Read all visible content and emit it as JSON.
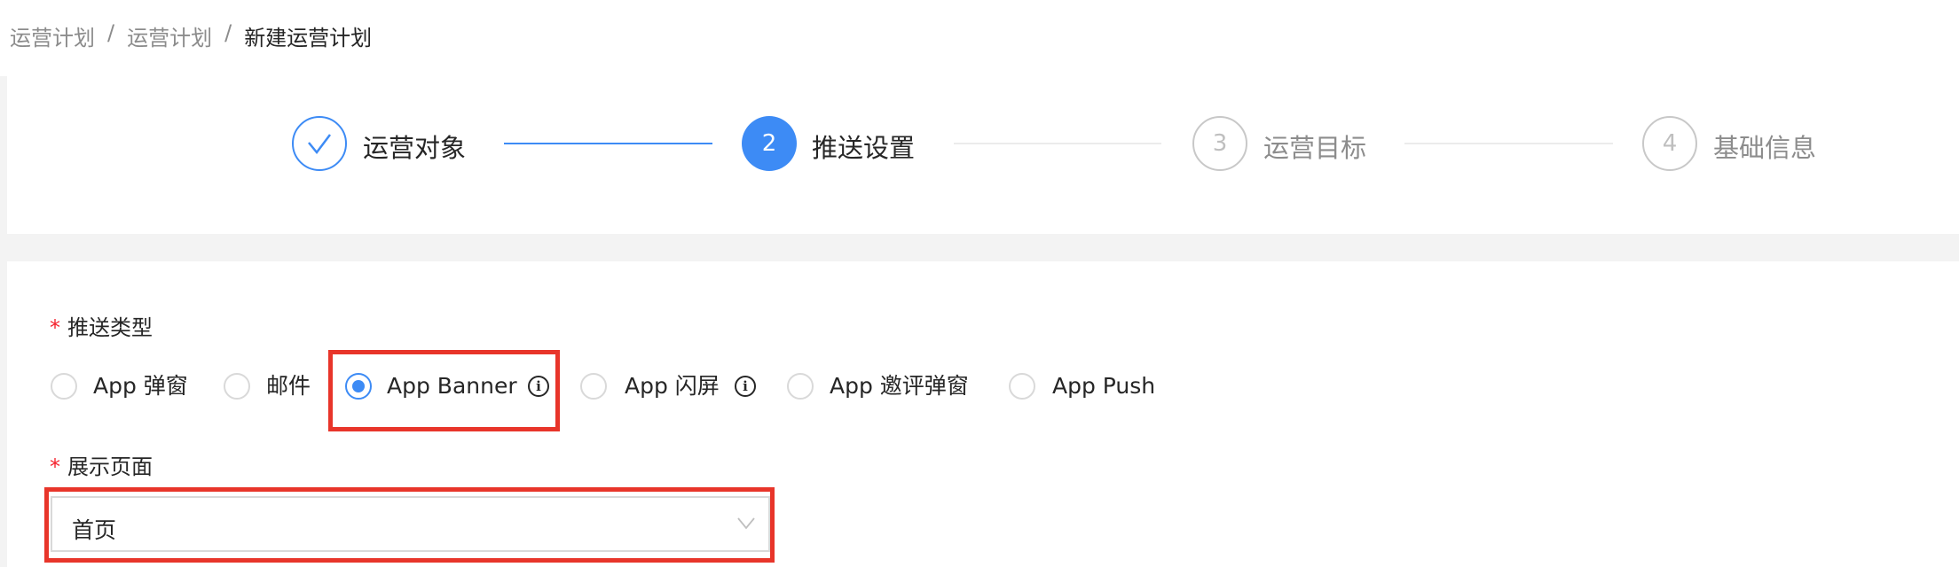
{
  "breadcrumb": {
    "items": [
      "运营计划",
      "运营计划",
      "新建运营计划"
    ],
    "separator": "/"
  },
  "steps": [
    {
      "index": "✓",
      "label": "运营对象",
      "status": "done"
    },
    {
      "index": "2",
      "label": "推送设置",
      "status": "active"
    },
    {
      "index": "3",
      "label": "运营目标",
      "status": "pending"
    },
    {
      "index": "4",
      "label": "基础信息",
      "status": "pending"
    }
  ],
  "form": {
    "push_type": {
      "required_mark": "*",
      "label": "推送类型",
      "options": [
        "App 弹窗",
        "邮件",
        "App Banner",
        "App 闪屏",
        "App 邀评弹窗",
        "App Push"
      ],
      "selected": "App Banner",
      "info_icon": "i"
    },
    "display_page": {
      "required_mark": "*",
      "label": "展示页面",
      "value": "首页"
    }
  },
  "colors": {
    "primary": "#3d8bf5",
    "highlight": "#e8352a",
    "required": "#f5222d"
  }
}
